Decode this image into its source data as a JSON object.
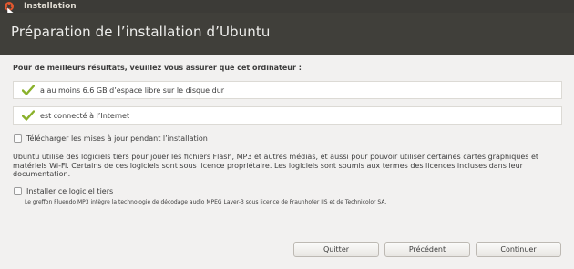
{
  "window": {
    "title": "Installation"
  },
  "header": {
    "title": "Préparation de l’installation d’Ubuntu"
  },
  "requirements": {
    "intro": "Pour de meilleurs résultats, veuillez vous assurer que cet ordinateur :",
    "items": [
      {
        "label": "a au moins 6.6 GB d’espace libre sur le disque dur",
        "icon": "check-icon"
      },
      {
        "label": "est connecté à l’Internet",
        "icon": "check-icon"
      }
    ]
  },
  "options": {
    "updates_label": "Télécharger les mises à jour pendant l’installation",
    "updates_checked": false,
    "third_party_text": "Ubuntu utilise des logiciels tiers pour jouer les fichiers Flash, MP3 et autres médias, et aussi pour pouvoir utiliser certaines cartes graphiques et matériels Wi-Fi. Certains de ces logiciels sont sous licence propriétaire. Les logiciels sont soumis aux termes des licences incluses dans leur documentation.",
    "third_party_label": "Installer ce logiciel tiers",
    "third_party_checked": false,
    "third_party_note": "Le greffon Fluendo MP3 intègre la technologie de décodage audio MPEG Layer-3 sous licence de Fraunhofer IIS et de Technicolor SA."
  },
  "buttons": {
    "quit": "Quitter",
    "previous": "Précédent",
    "continue": "Continuer"
  },
  "colors": {
    "header_bg": "#403f3a",
    "titlebar_bg": "#3c3b37",
    "close_button": "#e4572e",
    "check": "#8ab12b"
  }
}
